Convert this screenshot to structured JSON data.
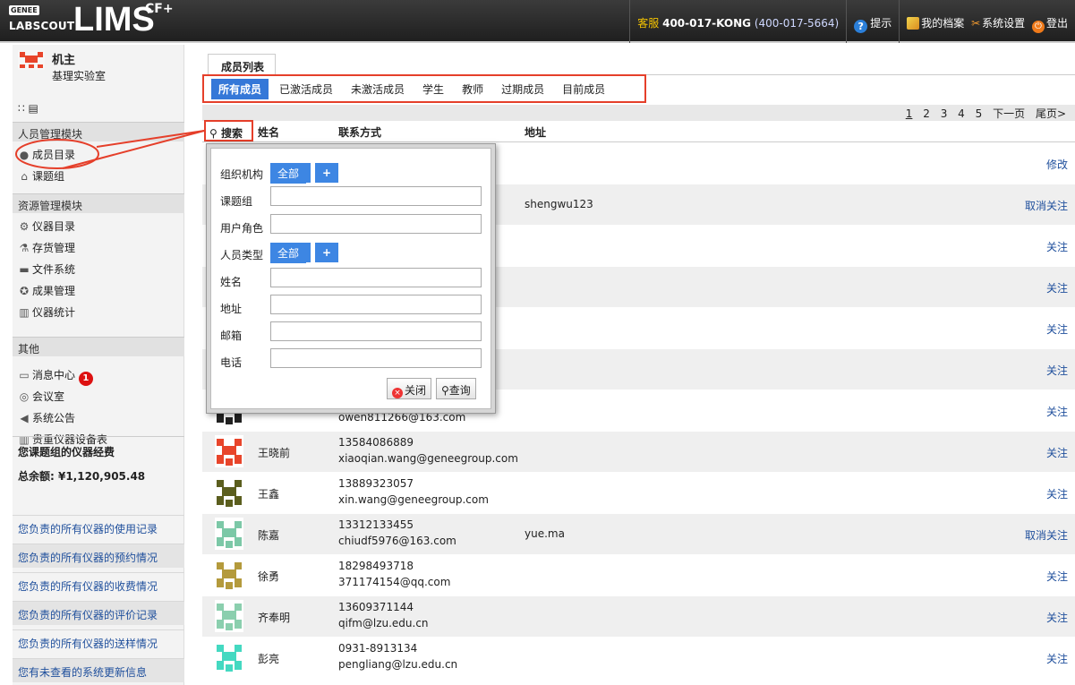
{
  "header": {
    "logo_genee": "GENEE",
    "logo_labscout": "LABSCOUT",
    "logo_lims": "LIMS",
    "logo_cf": "CF+",
    "service_label": "客服",
    "service_phone": "400-017-KONG",
    "service_alt": "(400-017-5664)",
    "hint": "提示",
    "profile": "我的档案",
    "settings": "系统设置",
    "logout": "登出"
  },
  "sidebar": {
    "user_name": "机主",
    "lab_name": "基理实验室",
    "view_icons": "∷ ▤",
    "section_people": "人员管理模块",
    "members": "成员目录",
    "groups": "课题组",
    "section_resources": "资源管理模块",
    "instruments": "仪器目录",
    "inventory": "存货管理",
    "files": "文件系统",
    "achievements": "成果管理",
    "instrument_stats": "仪器统计",
    "section_other": "其他",
    "messages": "消息中心",
    "messages_count": "1",
    "meeting": "会议室",
    "announcements": "系统公告",
    "equipment_table": "贵重仪器设备表",
    "funds_title": "您课题组的仪器经费",
    "funds_total": "总余额: ¥1,120,905.48",
    "links": [
      "您负责的所有仪器的使用记录",
      "您负责的所有仪器的预约情况",
      "您负责的所有仪器的收费情况",
      "您负责的所有仪器的评价记录",
      "您负责的所有仪器的送样情况",
      "您有未查看的系统更新信息"
    ]
  },
  "main": {
    "tab_title": "成员列表",
    "filters": [
      "所有成员",
      "已激活成员",
      "未激活成员",
      "学生",
      "教师",
      "过期成员",
      "目前成员"
    ],
    "pager": {
      "pages": [
        "1",
        "2",
        "3",
        "4",
        "5"
      ],
      "next": "下一页",
      "last": "尾页>"
    },
    "columns": {
      "search": "搜索",
      "name": "姓名",
      "contact": "联系方式",
      "address": "地址"
    },
    "rows": [
      {
        "name": "",
        "phone": "",
        "email": "",
        "address": "",
        "action": "修改"
      },
      {
        "name": "",
        "phone": "",
        "email": "",
        "address": "shengwu123",
        "action": "取消关注"
      },
      {
        "name": "",
        "phone": "",
        "email": "",
        "address": "",
        "action": "关注"
      },
      {
        "name": "",
        "phone": "",
        "email": "",
        "address": "",
        "action": "关注"
      },
      {
        "name": "",
        "phone": "",
        "email": "",
        "address": "",
        "action": "关注"
      },
      {
        "name": "",
        "phone": "",
        "email": "",
        "address": "",
        "action": "关注"
      },
      {
        "name": "",
        "phone": "",
        "email": "owen811266@163.com",
        "address": "",
        "action": "关注"
      },
      {
        "name": "王晓前",
        "phone": "13584086889",
        "email": "xiaoqian.wang@geneegroup.com",
        "address": "",
        "action": "关注"
      },
      {
        "name": "王鑫",
        "phone": "13889323057",
        "email": "xin.wang@geneegroup.com",
        "address": "",
        "action": "关注"
      },
      {
        "name": "陈嘉",
        "phone": "13312133455",
        "email": "chiudf5976@163.com",
        "address": "yue.ma",
        "action": "取消关注"
      },
      {
        "name": "徐勇",
        "phone": "18298493718",
        "email": "371174154@qq.com",
        "address": "",
        "action": "关注"
      },
      {
        "name": "齐奉明",
        "phone": "13609371144",
        "email": "qifm@lzu.edu.cn",
        "address": "",
        "action": "关注"
      },
      {
        "name": "彭亮",
        "phone": "0931-8913134",
        "email": "pengliang@lzu.edu.cn",
        "address": "",
        "action": "关注"
      }
    ]
  },
  "search_popup": {
    "org_label": "组织机构",
    "org_value": "全部",
    "group_label": "课题组",
    "role_label": "用户角色",
    "type_label": "人员类型",
    "type_value": "全部",
    "name_label": "姓名",
    "address_label": "地址",
    "email_label": "邮箱",
    "phone_label": "电话",
    "close": "关闭",
    "query": "查询"
  },
  "colors": {
    "accent": "#3578d8",
    "highlight": "#e53f2a",
    "link": "#1f4f9c"
  },
  "icons": {
    "hint": "question-icon",
    "profile": "edit-icon",
    "settings": "tools-icon",
    "logout": "power-icon",
    "search": "magnifier-icon"
  }
}
